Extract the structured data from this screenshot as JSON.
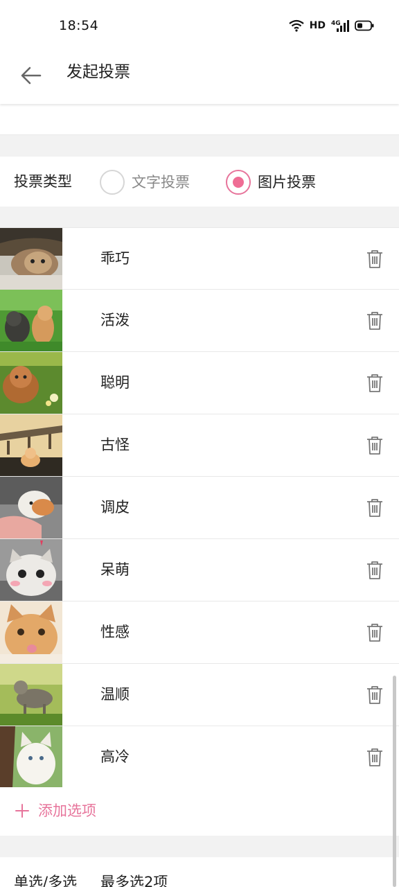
{
  "status_bar": {
    "time": "18:54",
    "network_label": "HD",
    "signal_label": "4G"
  },
  "header": {
    "back_icon": "arrow-left-icon",
    "title": "发起投票"
  },
  "vote_type": {
    "label": "投票类型",
    "options": [
      {
        "label": "文字投票",
        "selected": false
      },
      {
        "label": "图片投票",
        "selected": true
      }
    ]
  },
  "options": [
    {
      "label": "乖巧",
      "image": "cat-lying-photo"
    },
    {
      "label": "活泼",
      "image": "two-cats-grass-photo"
    },
    {
      "label": "聪明",
      "image": "kitten-flowers-photo"
    },
    {
      "label": "古怪",
      "image": "kitten-bridge-photo"
    },
    {
      "label": "调皮",
      "image": "kitten-hand-photo"
    },
    {
      "label": "呆萌",
      "image": "cute-cat-face-photo"
    },
    {
      "label": "性感",
      "image": "kitten-tongue-photo"
    },
    {
      "label": "温顺",
      "image": "tabby-cat-grass-photo"
    },
    {
      "label": "高冷",
      "image": "white-cat-tree-photo"
    }
  ],
  "delete_icon": "trash-icon",
  "add_option": {
    "label": "添加选项"
  },
  "selection_mode": {
    "label": "单选/多选",
    "value": "最多选2项"
  },
  "colors": {
    "accent": "#e7749b",
    "radio_dot": "#ef6d95",
    "separator": "#f2f2f2"
  }
}
